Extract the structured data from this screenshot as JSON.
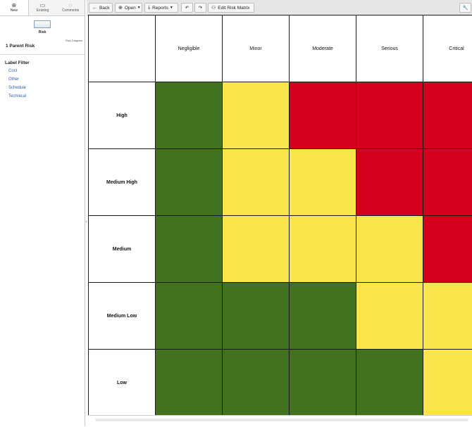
{
  "sidebar": {
    "tabs": [
      {
        "label": "New",
        "icon": "plus-circle-icon"
      },
      {
        "label": "Existing",
        "icon": "folder-icon"
      },
      {
        "label": "Comments",
        "icon": "comment-icon"
      }
    ],
    "risk_label": "Risk",
    "diagram_label": "Risk Diagram",
    "parent_risk": "1 Parent Risk",
    "filter_title": "Label Filter",
    "filters": [
      "Cost",
      "Other",
      "Schedule",
      "Technical"
    ]
  },
  "toolbar": {
    "back": "Back",
    "open": "Open",
    "reports": "Reports",
    "edit_matrix": "Edit Risk Matrix"
  },
  "matrix": {
    "columns": [
      "Negligible",
      "Minor",
      "Moderate",
      "Serious",
      "Critical"
    ],
    "rows": [
      {
        "label": "High",
        "cells": [
          "green",
          "yellow",
          "red",
          "red",
          "red"
        ]
      },
      {
        "label": "Medium High",
        "cells": [
          "green",
          "yellow",
          "yellow",
          "red",
          "red"
        ]
      },
      {
        "label": "Medium",
        "cells": [
          "green",
          "yellow",
          "yellow",
          "yellow",
          "red"
        ]
      },
      {
        "label": "Medium Low",
        "cells": [
          "green",
          "green",
          "green",
          "yellow",
          "yellow"
        ]
      },
      {
        "label": "Low",
        "cells": [
          "green",
          "green",
          "green",
          "green",
          "yellow"
        ]
      }
    ],
    "colors": {
      "green": "#40721f",
      "yellow": "#f9e44a",
      "red": "#d4001c"
    }
  }
}
